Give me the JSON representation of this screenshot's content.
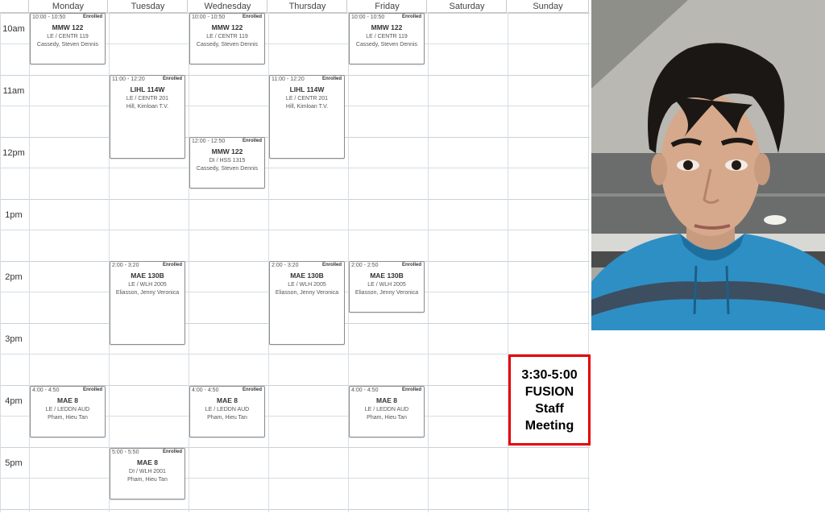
{
  "days": [
    "Monday",
    "Tuesday",
    "Wednesday",
    "Thursday",
    "Friday",
    "Saturday",
    "Sunday"
  ],
  "times": [
    "10am",
    "11am",
    "12pm",
    "1pm",
    "2pm",
    "3pm",
    "4pm",
    "5pm"
  ],
  "events": [
    {
      "time": "10:00 - 10:50",
      "status": "Enrolled",
      "course": "MMW 122",
      "location": "LE / CENTR 119",
      "instructor": "Cassedy, Steven Dennis"
    },
    {
      "time": "10:00 - 10:50",
      "status": "Enrolled",
      "course": "MMW 122",
      "location": "LE / CENTR 119",
      "instructor": "Cassedy, Steven Dennis"
    },
    {
      "time": "10:00 - 10:50",
      "status": "Enrolled",
      "course": "MMW 122",
      "location": "LE / CENTR 119",
      "instructor": "Cassedy, Steven Dennis"
    },
    {
      "time": "11:00 - 12:20",
      "status": "Enrolled",
      "course": "LIHL 114W",
      "location": "LE / CENTR 201",
      "instructor": "Hill, Kimloan T.V."
    },
    {
      "time": "11:00 - 12:20",
      "status": "Enrolled",
      "course": "LIHL 114W",
      "location": "LE / CENTR 201",
      "instructor": "Hill, Kimloan T.V."
    },
    {
      "time": "12:00 - 12:50",
      "status": "Enrolled",
      "course": "MMW 122",
      "location": "DI / HSS 1315",
      "instructor": "Cassedy, Steven Dennis"
    },
    {
      "time": "2:00 - 3:20",
      "status": "Enrolled",
      "course": "MAE 130B",
      "location": "LE / WLH 2005",
      "instructor": "Eliasson, Jenny Veronica"
    },
    {
      "time": "2:00 - 3:20",
      "status": "Enrolled",
      "course": "MAE 130B",
      "location": "LE / WLH 2005",
      "instructor": "Eliasson, Jenny Veronica"
    },
    {
      "time": "2:00 - 2:50",
      "status": "Enrolled",
      "course": "MAE 130B",
      "location": "LE / WLH 2005",
      "instructor": "Eliasson, Jenny Veronica"
    },
    {
      "time": "4:00 - 4:50",
      "status": "Enrolled",
      "course": "MAE 8",
      "location": "LE / LEDDN AUD",
      "instructor": "Pham, Hieu Tan"
    },
    {
      "time": "4:00 - 4:50",
      "status": "Enrolled",
      "course": "MAE 8",
      "location": "LE / LEDDN AUD",
      "instructor": "Pham, Hieu Tan"
    },
    {
      "time": "4:00 - 4:50",
      "status": "Enrolled",
      "course": "MAE 8",
      "location": "LE / LEDDN AUD",
      "instructor": "Pham, Hieu Tan"
    },
    {
      "time": "5:00 - 5:50",
      "status": "Enrolled",
      "course": "MAE 8",
      "location": "DI / WLH 2001",
      "instructor": "Pham, Hieu Tan"
    }
  ],
  "staff_meeting": {
    "lines": [
      "3:30-5:00",
      "FUSION",
      "Staff",
      "Meeting"
    ],
    "border_color": "#e60000"
  },
  "photo": {
    "icon": "person-photo"
  }
}
